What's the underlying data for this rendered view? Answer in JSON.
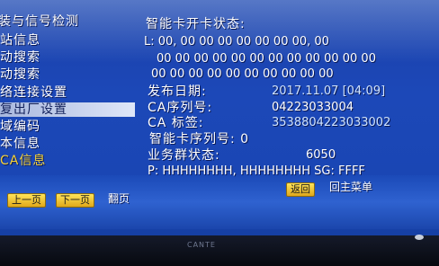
{
  "left_menu": {
    "items": [
      {
        "label": "装与信号检测"
      },
      {
        "label": "站信息"
      },
      {
        "label": "动搜索"
      },
      {
        "label": "动搜索"
      },
      {
        "label": "络连接设置"
      },
      {
        "label": "复出厂设置"
      },
      {
        "label": "域编码"
      },
      {
        "label": "本信息"
      },
      {
        "label": "CA信息"
      }
    ],
    "selected_index": 5,
    "highlighted_index": 8
  },
  "card_status": {
    "title": "智能卡开卡状态:",
    "l_line": "L: 00, 00 00 00 00 00 00 00, 00",
    "row2": "00 00 00 00 00 00 00 00 00 00 00 00",
    "row3": "00 00 00 00 00 00 00 00 00 00",
    "publish_date_label": "发布日期:",
    "publish_date_value": "2017.11.07 [04:09]",
    "ca_serial_label": "CA序列号:",
    "ca_serial_value": "04223033004",
    "ca_tag_label": "CA  标签:",
    "ca_tag_value": "3538804223033002",
    "smartcard_serial_label": "智能卡序列号: 0",
    "business_group_label": "业务群状态:",
    "business_group_value": "6050",
    "p_line": "P: HHHHHHHH, HHHHHHHH SG: FFFF"
  },
  "bottom_bar": {
    "prev_page_button": "上一页",
    "next_page_button": "下一页",
    "page_hint": "翻页",
    "back_button": "返回",
    "back_hint": "回主菜单"
  },
  "bezel": {
    "brand": "CANTE"
  },
  "colors": {
    "screen_blue": "#1c48b8",
    "menu_selected": "#c8d4f0",
    "highlight_yellow": "#f5d23a",
    "button_yellow": "#f0c030"
  }
}
